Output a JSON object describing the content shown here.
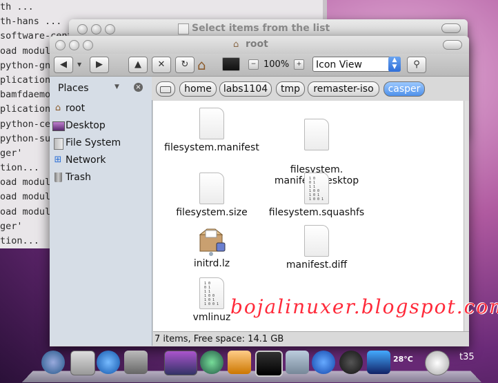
{
  "terminal": {
    "lines": [
      "th ...",
      "th-hans ...",
      "software-cent",
      "oad modul",
      "python-gn",
      "plication",
      "bamfdaemo",
      "plication",
      "python-ce",
      "python-su",
      "ger'",
      "tion...",
      "oad modul",
      "oad modul",
      "oad modul",
      "ger'",
      "tion...",
      "oad modul",
      "oad modul"
    ]
  },
  "dialog": {
    "title": "Select items from the list"
  },
  "window": {
    "title": "root"
  },
  "toolbar": {
    "back_icon": "arrow-left-icon",
    "forward_icon": "arrow-right-icon",
    "zoom": "100%",
    "view_mode": "Icon View"
  },
  "sidebar": {
    "header": "Places",
    "items": [
      {
        "label": "root",
        "icon": "home-icon"
      },
      {
        "label": "Desktop",
        "icon": "desktop-icon"
      },
      {
        "label": "File System",
        "icon": "drive-icon"
      },
      {
        "label": "Network",
        "icon": "network-icon"
      },
      {
        "label": "Trash",
        "icon": "trash-icon"
      }
    ]
  },
  "pathbar": {
    "crumbs": [
      "home",
      "labs1104",
      "tmp",
      "remaster-iso",
      "casper"
    ],
    "active": "casper"
  },
  "files": [
    {
      "name": "filesystem.manifest",
      "type": "document"
    },
    {
      "name": "filesystem.\nmanifest-desktop",
      "type": "document"
    },
    {
      "name": "filesystem.size",
      "type": "document"
    },
    {
      "name": "filesystem.squashfs",
      "type": "binary"
    },
    {
      "name": "initrd.lz",
      "type": "package"
    },
    {
      "name": "manifest.diff",
      "type": "document"
    },
    {
      "name": "vmlinuz",
      "type": "binary"
    }
  ],
  "status": "7 items, Free space: 14.1 GB",
  "watermark": "bojalinuxer.blogspot.com",
  "dock": {
    "temperature": "28°C",
    "clock_label": "t35"
  },
  "colors": {
    "active_crumb": "#4f91ea",
    "sidebar_bg": "#d6dde6",
    "watermark": "#ff2a3a"
  }
}
